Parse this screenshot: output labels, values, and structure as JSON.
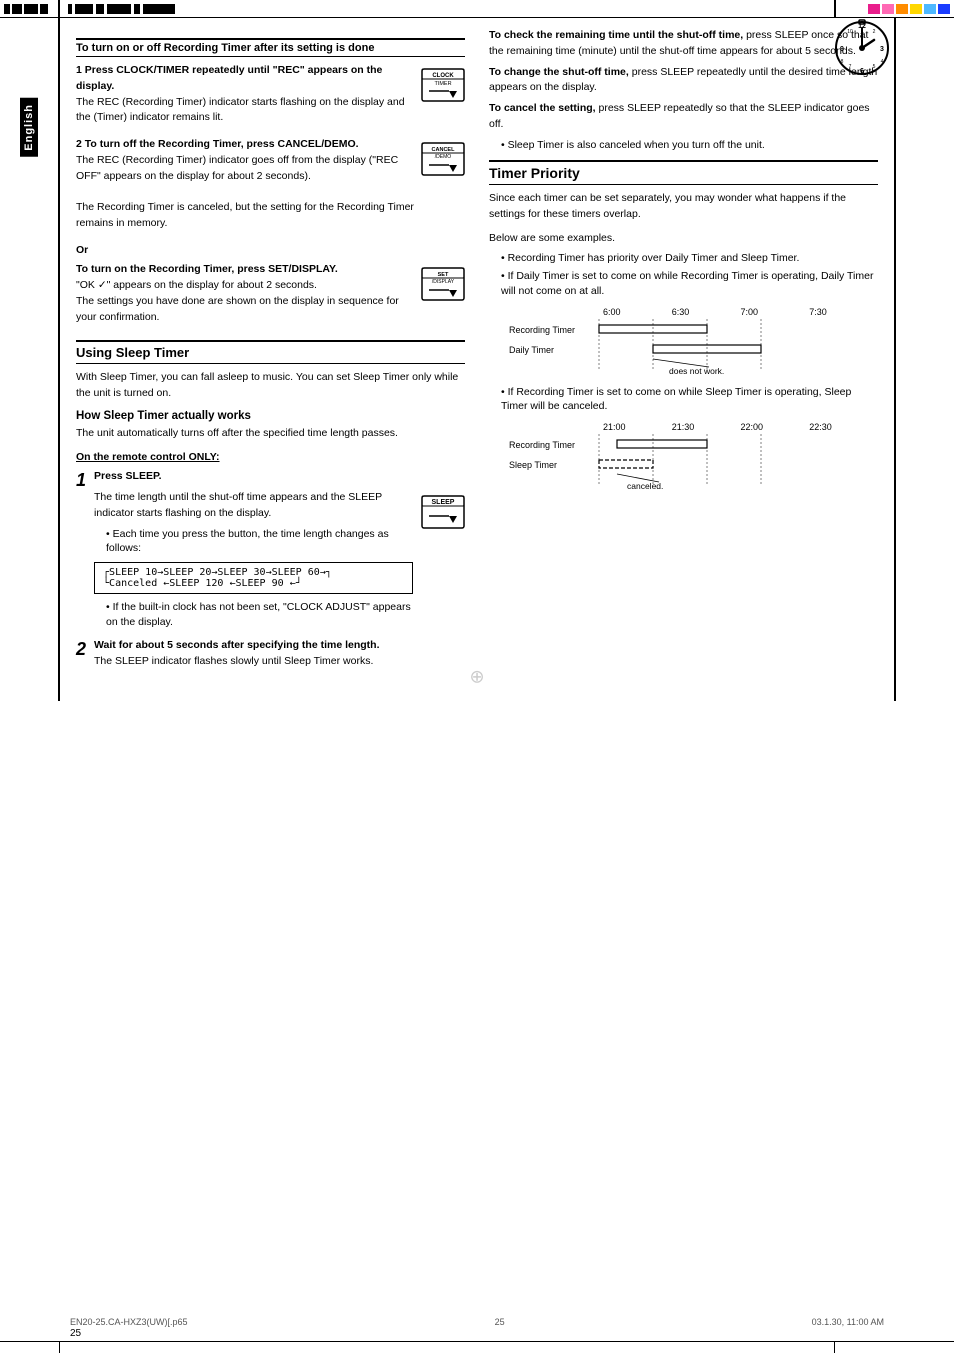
{
  "page": {
    "number": "25",
    "language_label": "English",
    "footer_left": "EN20-25.CA-HXZ3(UW)[.p65",
    "footer_center": "25",
    "footer_right": "03.1.30, 11:00 AM",
    "crosshair_symbol": "⊕"
  },
  "left_column": {
    "section1": {
      "heading": "To turn on or off Recording Timer after its setting is done",
      "step1_num": "1",
      "step1_title": "Press CLOCK/TIMER repeatedly until \"REC\" appears on the display.",
      "step1_body": "The REC (Recording Timer) indicator starts flashing on the display and the  (Timer) indicator remains lit.",
      "step2_num": "2",
      "step2_title": "To turn off the Recording Timer, press CANCEL/DEMO.",
      "step2_body1": "The REC (Recording Timer) indicator goes off from the display (\"REC OFF\" appears on the display for about 2 seconds).",
      "step2_body2": "The Recording Timer is canceled, but the setting for the Recording Timer remains in memory.",
      "or_label": "Or",
      "step3_title": "To turn on the Recording Timer, press SET/DISPLAY.",
      "step3_body": "\"OK ✓\" appears on the display for about 2 seconds.",
      "step3_body2": "The settings you have done are shown on the display in sequence for your confirmation."
    },
    "section2": {
      "heading": "Using Sleep Timer",
      "intro": "With Sleep Timer, you can fall asleep to music. You can set Sleep Timer only while the unit is turned on.",
      "subsection_heading": "How Sleep Timer actually works",
      "subsection_body": "The unit automatically turns off after the specified time length passes.",
      "on_remote_label": "On the remote control ONLY:",
      "step1_num": "1",
      "step1_title": "Press SLEEP.",
      "step1_body1": "The time length until the shut-off time appears and the SLEEP indicator starts flashing on the display.",
      "step1_bullet1": "Each time you press the button, the time length changes as follows:",
      "sleep_cycle": "SLEEP 10→SLEEP 20→SLEEP 30→SLEEP 60→",
      "sleep_cycle2": "Canceled ←SLEEP 120 ←SLEEP 90 ←",
      "step1_bullet2": "If the built-in clock has not been set, \"CLOCK ADJUST\" appears on the display.",
      "step2_num": "2",
      "step2_title": "Wait for about 5 seconds after specifying the time length.",
      "step2_body": "The SLEEP indicator flashes slowly until Sleep Timer works."
    }
  },
  "right_column": {
    "para1_label": "To check the remaining time until the shut-off time,",
    "para1_body": " press SLEEP once so that the remaining time (minute) until the shut-off time appears for about 5 seconds.",
    "para2_label": "To change the shut-off time,",
    "para2_body": " press SLEEP repeatedly until the desired time length appears on the display.",
    "para3_label": "To cancel the setting,",
    "para3_body": " press SLEEP repeatedly so that the SLEEP indicator goes off.",
    "para3_bullet": "Sleep Timer is also canceled when you turn off the unit.",
    "timer_priority": {
      "heading": "Timer Priority",
      "intro": "Since each timer can be set separately, you may wonder what happens if the settings for these timers overlap.",
      "below_label": "Below are some examples.",
      "bullet1": "Recording Timer has priority over Daily Timer and Sleep Timer.",
      "bullet2": "If Daily Timer is set to come on while Recording Timer is operating, Daily Timer will not come on at all.",
      "diagram1": {
        "time_labels": [
          "6:00",
          "6:30",
          "7:00",
          "7:30"
        ],
        "row1_label": "Recording Timer",
        "row2_label": "Daily Timer",
        "does_not_work": "does not work."
      },
      "bullet3": "If Recording Timer is set to come on while Sleep Timer is operating, Sleep Timer will be canceled.",
      "diagram2": {
        "time_labels": [
          "21:00",
          "21:30",
          "22:00",
          "22:30"
        ],
        "row1_label": "Recording Timer",
        "row2_label": "Sleep Timer",
        "canceled": "canceled."
      }
    }
  },
  "top_bar_colors": [
    "#ff1493",
    "#ff69b4",
    "#ff8c00",
    "#ffd700",
    "#00bfff",
    "#4169e1"
  ]
}
